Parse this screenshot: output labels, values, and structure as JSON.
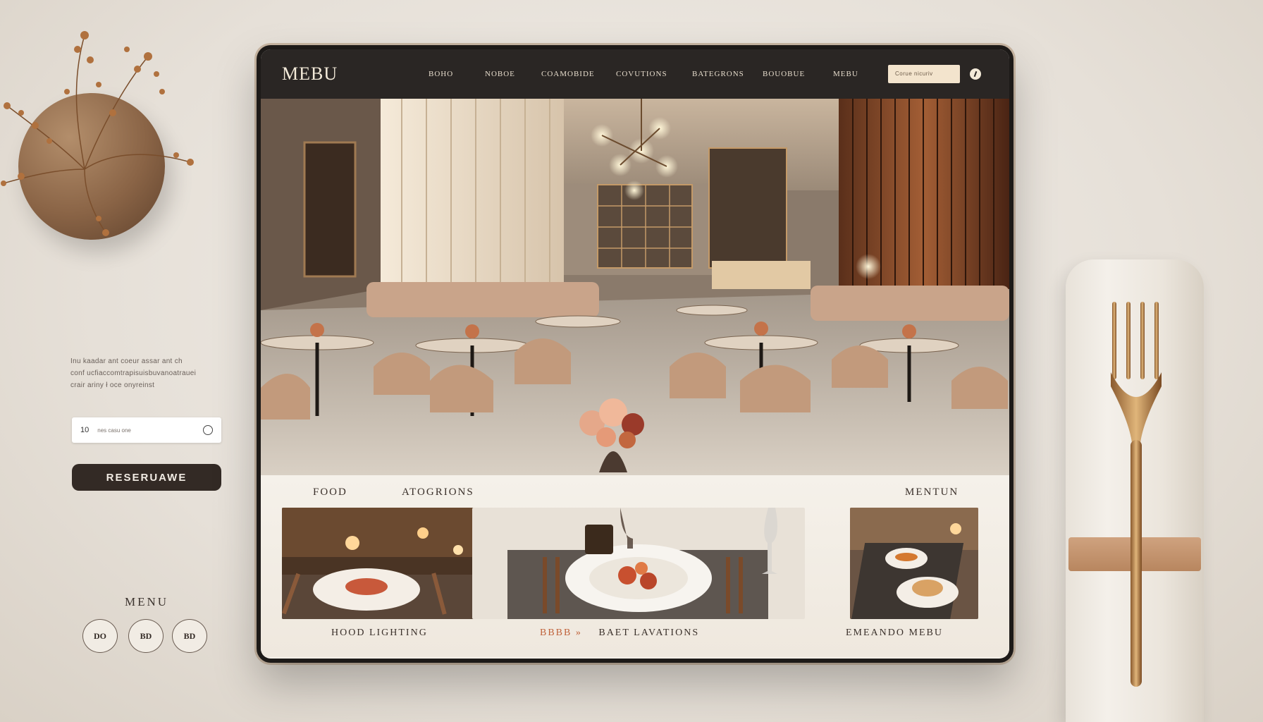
{
  "left_panel": {
    "description_lines": [
      "Inu kaadar ant coeur assar ant ch",
      "conf ucfiaccomtrapisuisbuvanoatrauei",
      "crair ariny ł oce onyreinst"
    ],
    "input": {
      "number": "10",
      "placeholder": "nes casu one"
    },
    "reserve_button": "RESERUAWE",
    "menu_label": "MENU",
    "circle_buttons": [
      "DO",
      "BD",
      "BD"
    ]
  },
  "tablet": {
    "logo": "MEBU",
    "nav": [
      "BOHO",
      "NOBOE",
      "COAMOBIDE",
      "COVUTIONS",
      "BATEGRONS",
      "BOUOBUE",
      "MEBU"
    ],
    "search_placeholder": "Corue nicuriv",
    "sections": {
      "left_title": "FOOD",
      "middle_title": "ATOGRIONS",
      "right_title": "MENTUN"
    },
    "cards": [
      {
        "label": "HOOD LIGHTING"
      },
      {
        "label_accent": "BBBB »",
        "label": "BAET LAVATIONS"
      },
      {
        "label": "EMEANDO MEBU"
      }
    ]
  },
  "icons": {
    "search": "search-icon",
    "input_action": "refresh-icon",
    "fork": "fork-icon"
  },
  "colors": {
    "topbar": "#2a2624",
    "accent_copper": "#c0623a",
    "button_dark": "#332a25",
    "upholstery": "#c9a48a"
  }
}
